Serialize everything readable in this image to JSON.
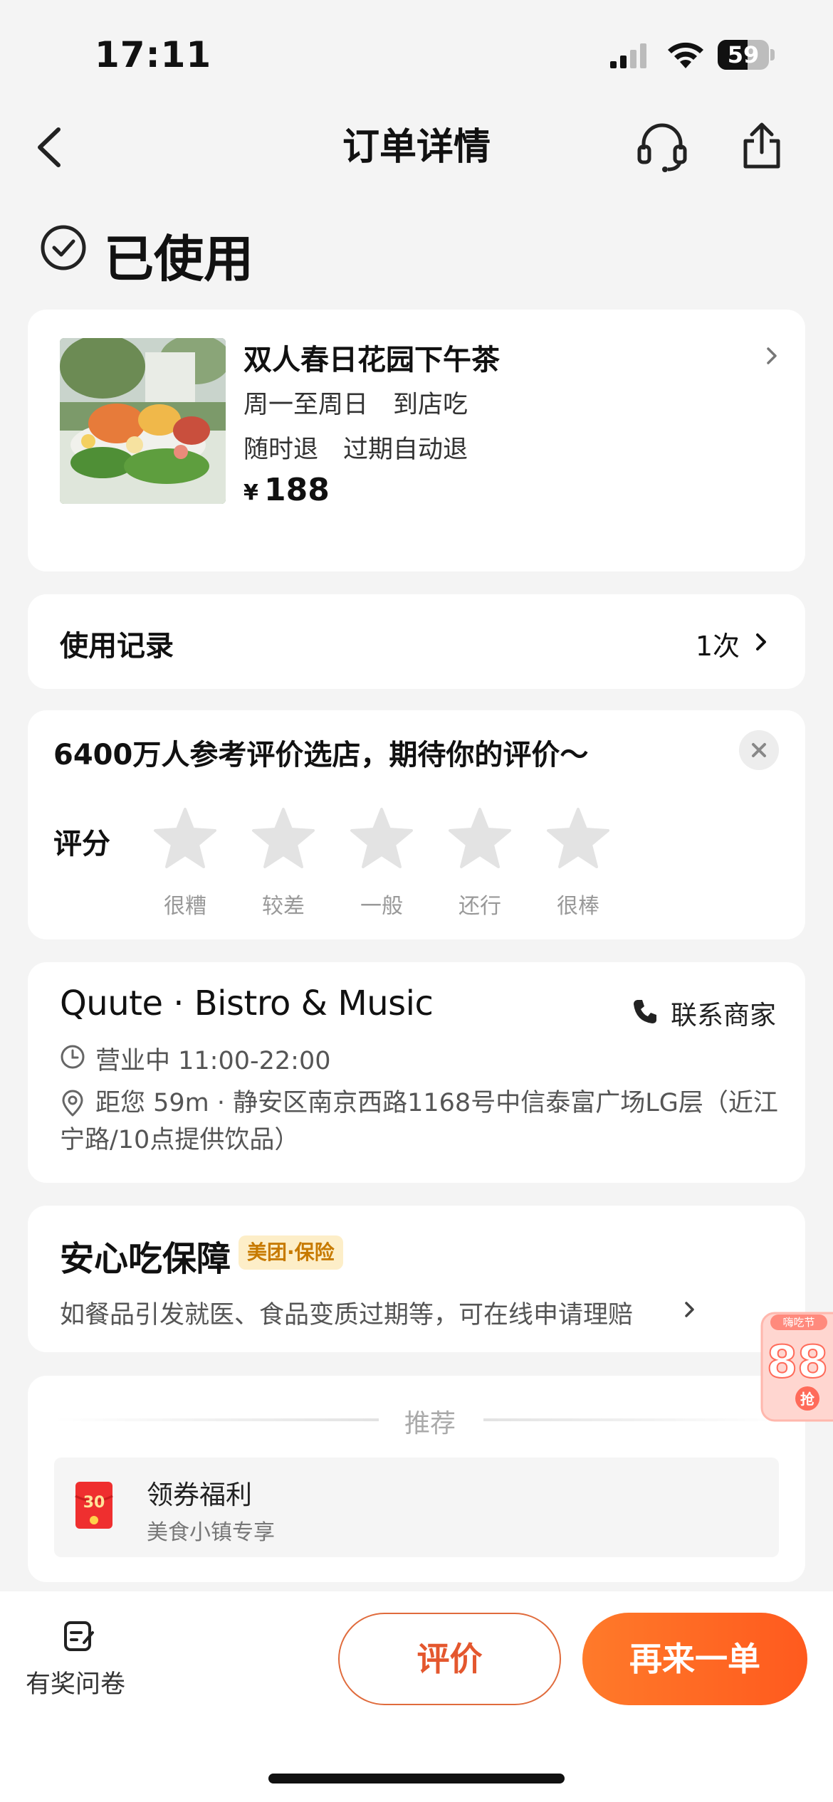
{
  "status_bar": {
    "time": "17:11",
    "battery": "59",
    "battery_level": 0.59
  },
  "nav": {
    "title": "订单详情"
  },
  "order_status": {
    "label": "已使用"
  },
  "product": {
    "title": "双人春日花园下午茶",
    "line1": "周一至周日　到店吃",
    "line2": "随时退　过期自动退",
    "price_symbol": "¥",
    "price": "188"
  },
  "usage": {
    "label": "使用记录",
    "count": "1次"
  },
  "review": {
    "prompt": "6400万人参考评价选店，期待你的评价～",
    "rating_label": "评分",
    "stars": [
      {
        "label": "很糟"
      },
      {
        "label": "较差"
      },
      {
        "label": "一般"
      },
      {
        "label": "还行"
      },
      {
        "label": "很棒"
      }
    ]
  },
  "merchant": {
    "name": "Quute · Bistro & Music",
    "contact_label": "联系商家",
    "hours": "营业中 11:00-22:00",
    "address": "距您 59m · 静安区南京西路1168号中信泰富广场LG层（近江宁路/10点提供饮品）"
  },
  "guarantee": {
    "title": "安心吃保障",
    "badge": "美团·保险",
    "desc": "如餐品引发就医、食品变质过期等，可在线申请理赔"
  },
  "float_badge": {
    "top": "嗨吃节",
    "value": "88",
    "action": "抢"
  },
  "recommend": {
    "title": "推荐",
    "item_title": "领券福利",
    "item_sub": "美食小镇专享",
    "item_icon_text": "30"
  },
  "bottom": {
    "survey_label": "有奖问卷",
    "review_button": "评价",
    "reorder_button": "再来一单"
  },
  "colors": {
    "accent": "#ff6a24",
    "page_bg": "#f4f4f4",
    "star_gray": "#e3e3e3"
  }
}
